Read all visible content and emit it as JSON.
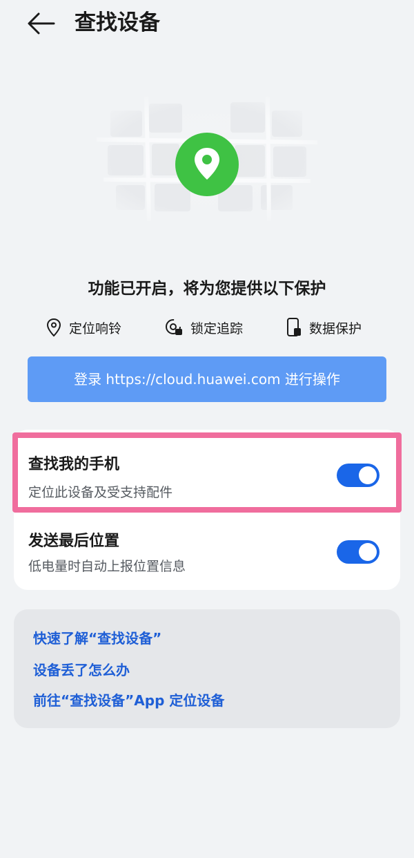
{
  "header": {
    "title": "查找设备"
  },
  "hero": {
    "subtitle": "功能已开启，将为您提供以下保护"
  },
  "features": [
    {
      "icon": "location-pin-icon",
      "label": "定位响铃"
    },
    {
      "icon": "lock-tracking-icon",
      "label": "锁定追踪"
    },
    {
      "icon": "phone-data-icon",
      "label": "数据保护"
    }
  ],
  "login": {
    "label": "登录 https://cloud.huawei.com 进行操作"
  },
  "settings": [
    {
      "title": "查找我的手机",
      "desc": "定位此设备及受支持配件",
      "enabled": true
    },
    {
      "title": "发送最后位置",
      "desc": "低电量时自动上报位置信息",
      "enabled": true
    }
  ],
  "links": [
    "快速了解“查找设备”",
    "设备丢了怎么办",
    "前往“查找设备”App 定位设备"
  ],
  "colors": {
    "accent": "#1a66e8",
    "login_button": "#5e9bf5",
    "highlight": "#f06d9d",
    "pin_green": "#3fc244"
  }
}
